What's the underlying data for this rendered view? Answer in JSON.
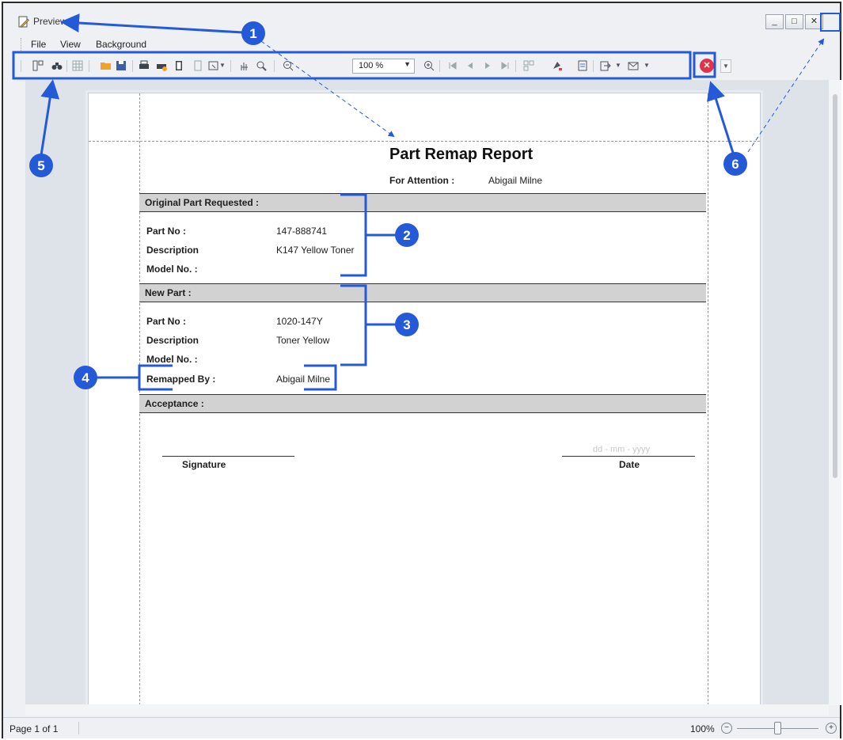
{
  "window": {
    "title": "Preview",
    "min_symbol": "_",
    "max_symbol": "□",
    "close_symbol": "✕"
  },
  "menu": {
    "file": "File",
    "view": "View",
    "background": "Background"
  },
  "toolbar": {
    "zoom_value": "100 %",
    "zoom_arrow": "▼",
    "stop_symbol": "✕",
    "more_symbol": "▼",
    "icons": [
      "panel-icon",
      "binoculars-icon",
      "thumbnails-icon",
      "open-icon",
      "save-icon",
      "print-icon",
      "quick-print-icon",
      "page-setup-icon",
      "header-footer-icon",
      "scale-icon",
      "hand-tool-icon",
      "magnifier-icon",
      "zoom-out-icon",
      "zoom-in-icon",
      "first-page-icon",
      "prev-page-icon",
      "next-page-icon",
      "last-page-icon",
      "multipage-icon",
      "color-icon",
      "watermark-icon",
      "export-icon",
      "send-icon",
      "stop-icon"
    ]
  },
  "report": {
    "title": "Part Remap Report",
    "attention_label": "For Attention :",
    "attention_value": "Abigail Milne",
    "original_section": "Original Part Requested :",
    "new_section": "New Part :",
    "acceptance_section": "Acceptance :",
    "original": {
      "part_no_label": "Part No :",
      "part_no": "147-888741",
      "description_label": "Description",
      "description": "K147 Yellow Toner",
      "model_label": "Model No. :"
    },
    "new": {
      "part_no_label": "Part No :",
      "part_no": "1020-147Y",
      "description_label": "Description",
      "description": "Toner Yellow",
      "model_label": "Model No. :",
      "remapped_label": "Remapped By :",
      "remapped_value": "Abigail Milne"
    },
    "signature_label": "Signature",
    "date_label": "Date",
    "date_placeholder": "dd - mm - yyyy"
  },
  "status": {
    "page": "Page 1 of 1",
    "zoom": "100%",
    "zoom_level": 0.5,
    "minus": "−",
    "plus": "+"
  },
  "annotations": {
    "color": "#2459d8",
    "badges": [
      "1",
      "2",
      "3",
      "4",
      "5",
      "6"
    ]
  }
}
